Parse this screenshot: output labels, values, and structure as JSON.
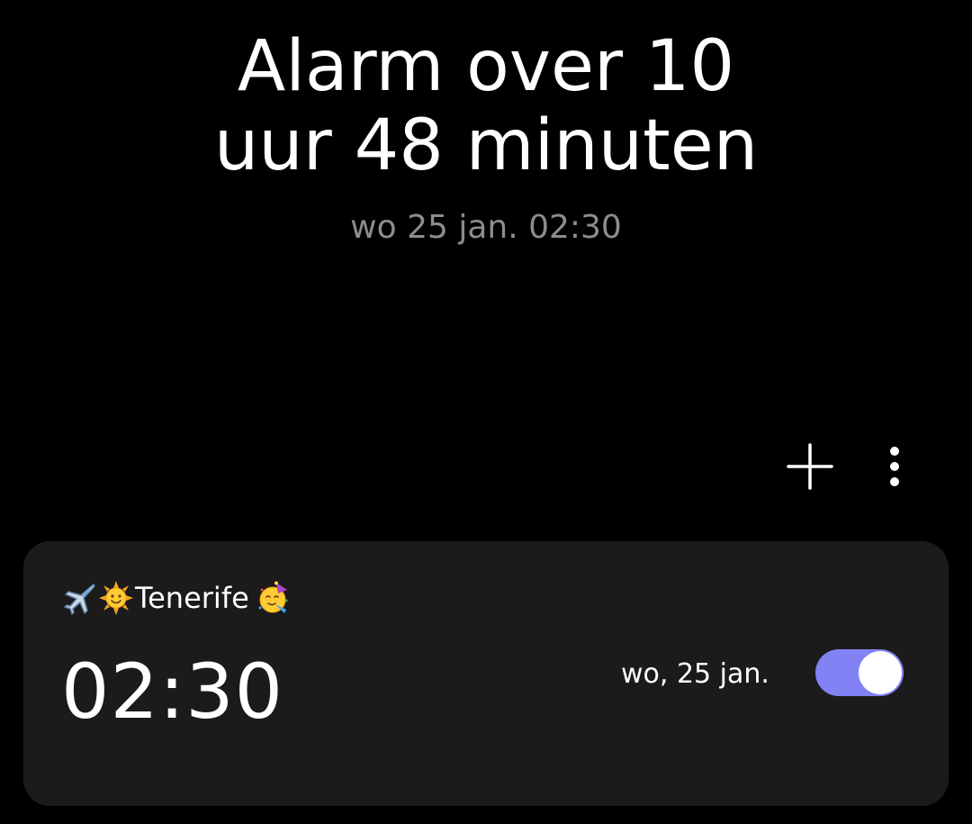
{
  "header": {
    "line1": "Alarm over 10",
    "line2": "uur 48 minuten",
    "next_alarm": "wo 25 jan. 02:30"
  },
  "toolbar": {
    "add_icon": "plus-icon",
    "more_icon": "more-vertical-icon"
  },
  "alarm": {
    "label_prefix_icons": [
      "airplane-emoji",
      "sun-with-face-emoji"
    ],
    "label": "Tenerife",
    "label_suffix_icon": "partying-face-emoji",
    "time": "02:30",
    "days": "wo, 25 jan.",
    "enabled": true
  },
  "colors": {
    "background": "#000000",
    "card": "#1b1b1b",
    "toggle_on": "#8282f5",
    "secondary_text": "#8d8d8d"
  }
}
